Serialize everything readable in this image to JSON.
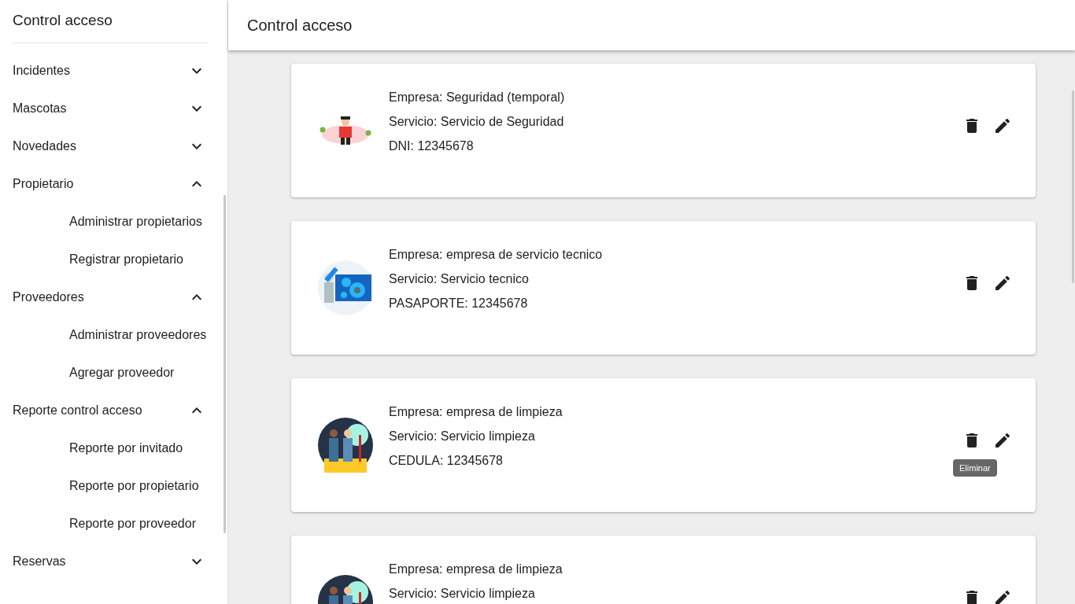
{
  "sidebar": {
    "title": "Control acceso",
    "groups": [
      {
        "label": "Incidentes",
        "expanded": false
      },
      {
        "label": "Mascotas",
        "expanded": false
      },
      {
        "label": "Novedades",
        "expanded": false
      },
      {
        "label": "Propietario",
        "expanded": true,
        "children": [
          "Administrar propietarios",
          "Registrar propietario"
        ]
      },
      {
        "label": "Proveedores",
        "expanded": true,
        "children": [
          "Administrar proveedores",
          "Agregar proveedor"
        ]
      },
      {
        "label": "Reporte control acceso",
        "expanded": true,
        "children": [
          "Reporte por invitado",
          "Reporte por propietario",
          "Reporte por proveedor"
        ]
      },
      {
        "label": "Reservas",
        "expanded": false
      }
    ]
  },
  "header": {
    "title": "Control acceso"
  },
  "cards": [
    {
      "kind": "security",
      "lines": [
        "Empresa: Seguridad (temporal)",
        "Servicio: Servicio de Seguridad",
        "DNI: 12345678"
      ]
    },
    {
      "kind": "tech",
      "lines": [
        "Empresa: empresa de servicio tecnico",
        "Servicio: Servicio tecnico",
        "PASAPORTE: 12345678"
      ]
    },
    {
      "kind": "cleaning",
      "lines": [
        "Empresa: empresa de limpieza",
        "Servicio: Servicio limpieza",
        "CEDULA: 12345678"
      ],
      "tooltip": "Eliminar"
    },
    {
      "kind": "cleaning",
      "lines": [
        "Empresa: empresa de limpieza",
        "Servicio: Servicio limpieza"
      ]
    }
  ]
}
